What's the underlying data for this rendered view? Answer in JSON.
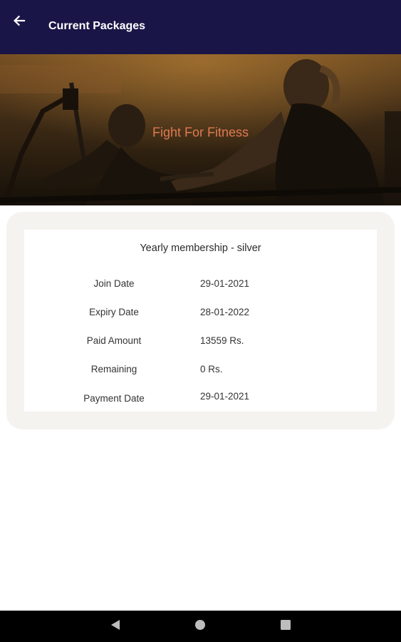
{
  "appbar": {
    "title": "Current Packages",
    "background": "#1a1547"
  },
  "hero": {
    "tagline": "Fight For Fitness",
    "tagline_color": "#e07a52"
  },
  "package": {
    "name": "Yearly membership - silver",
    "rows": [
      {
        "label": "Join Date",
        "value": "29-01-2021"
      },
      {
        "label": "Expiry Date",
        "value": "28-01-2022"
      },
      {
        "label": "Paid Amount",
        "value": "13559 Rs."
      },
      {
        "label": "Remaining",
        "value": "0 Rs."
      },
      {
        "label": "Payment Date",
        "value": "29-01-2021"
      }
    ]
  },
  "icons": {
    "back": "arrow-left-icon",
    "nav_back": "triangle-back-icon",
    "nav_home": "circle-home-icon",
    "nav_recents": "square-recents-icon"
  }
}
